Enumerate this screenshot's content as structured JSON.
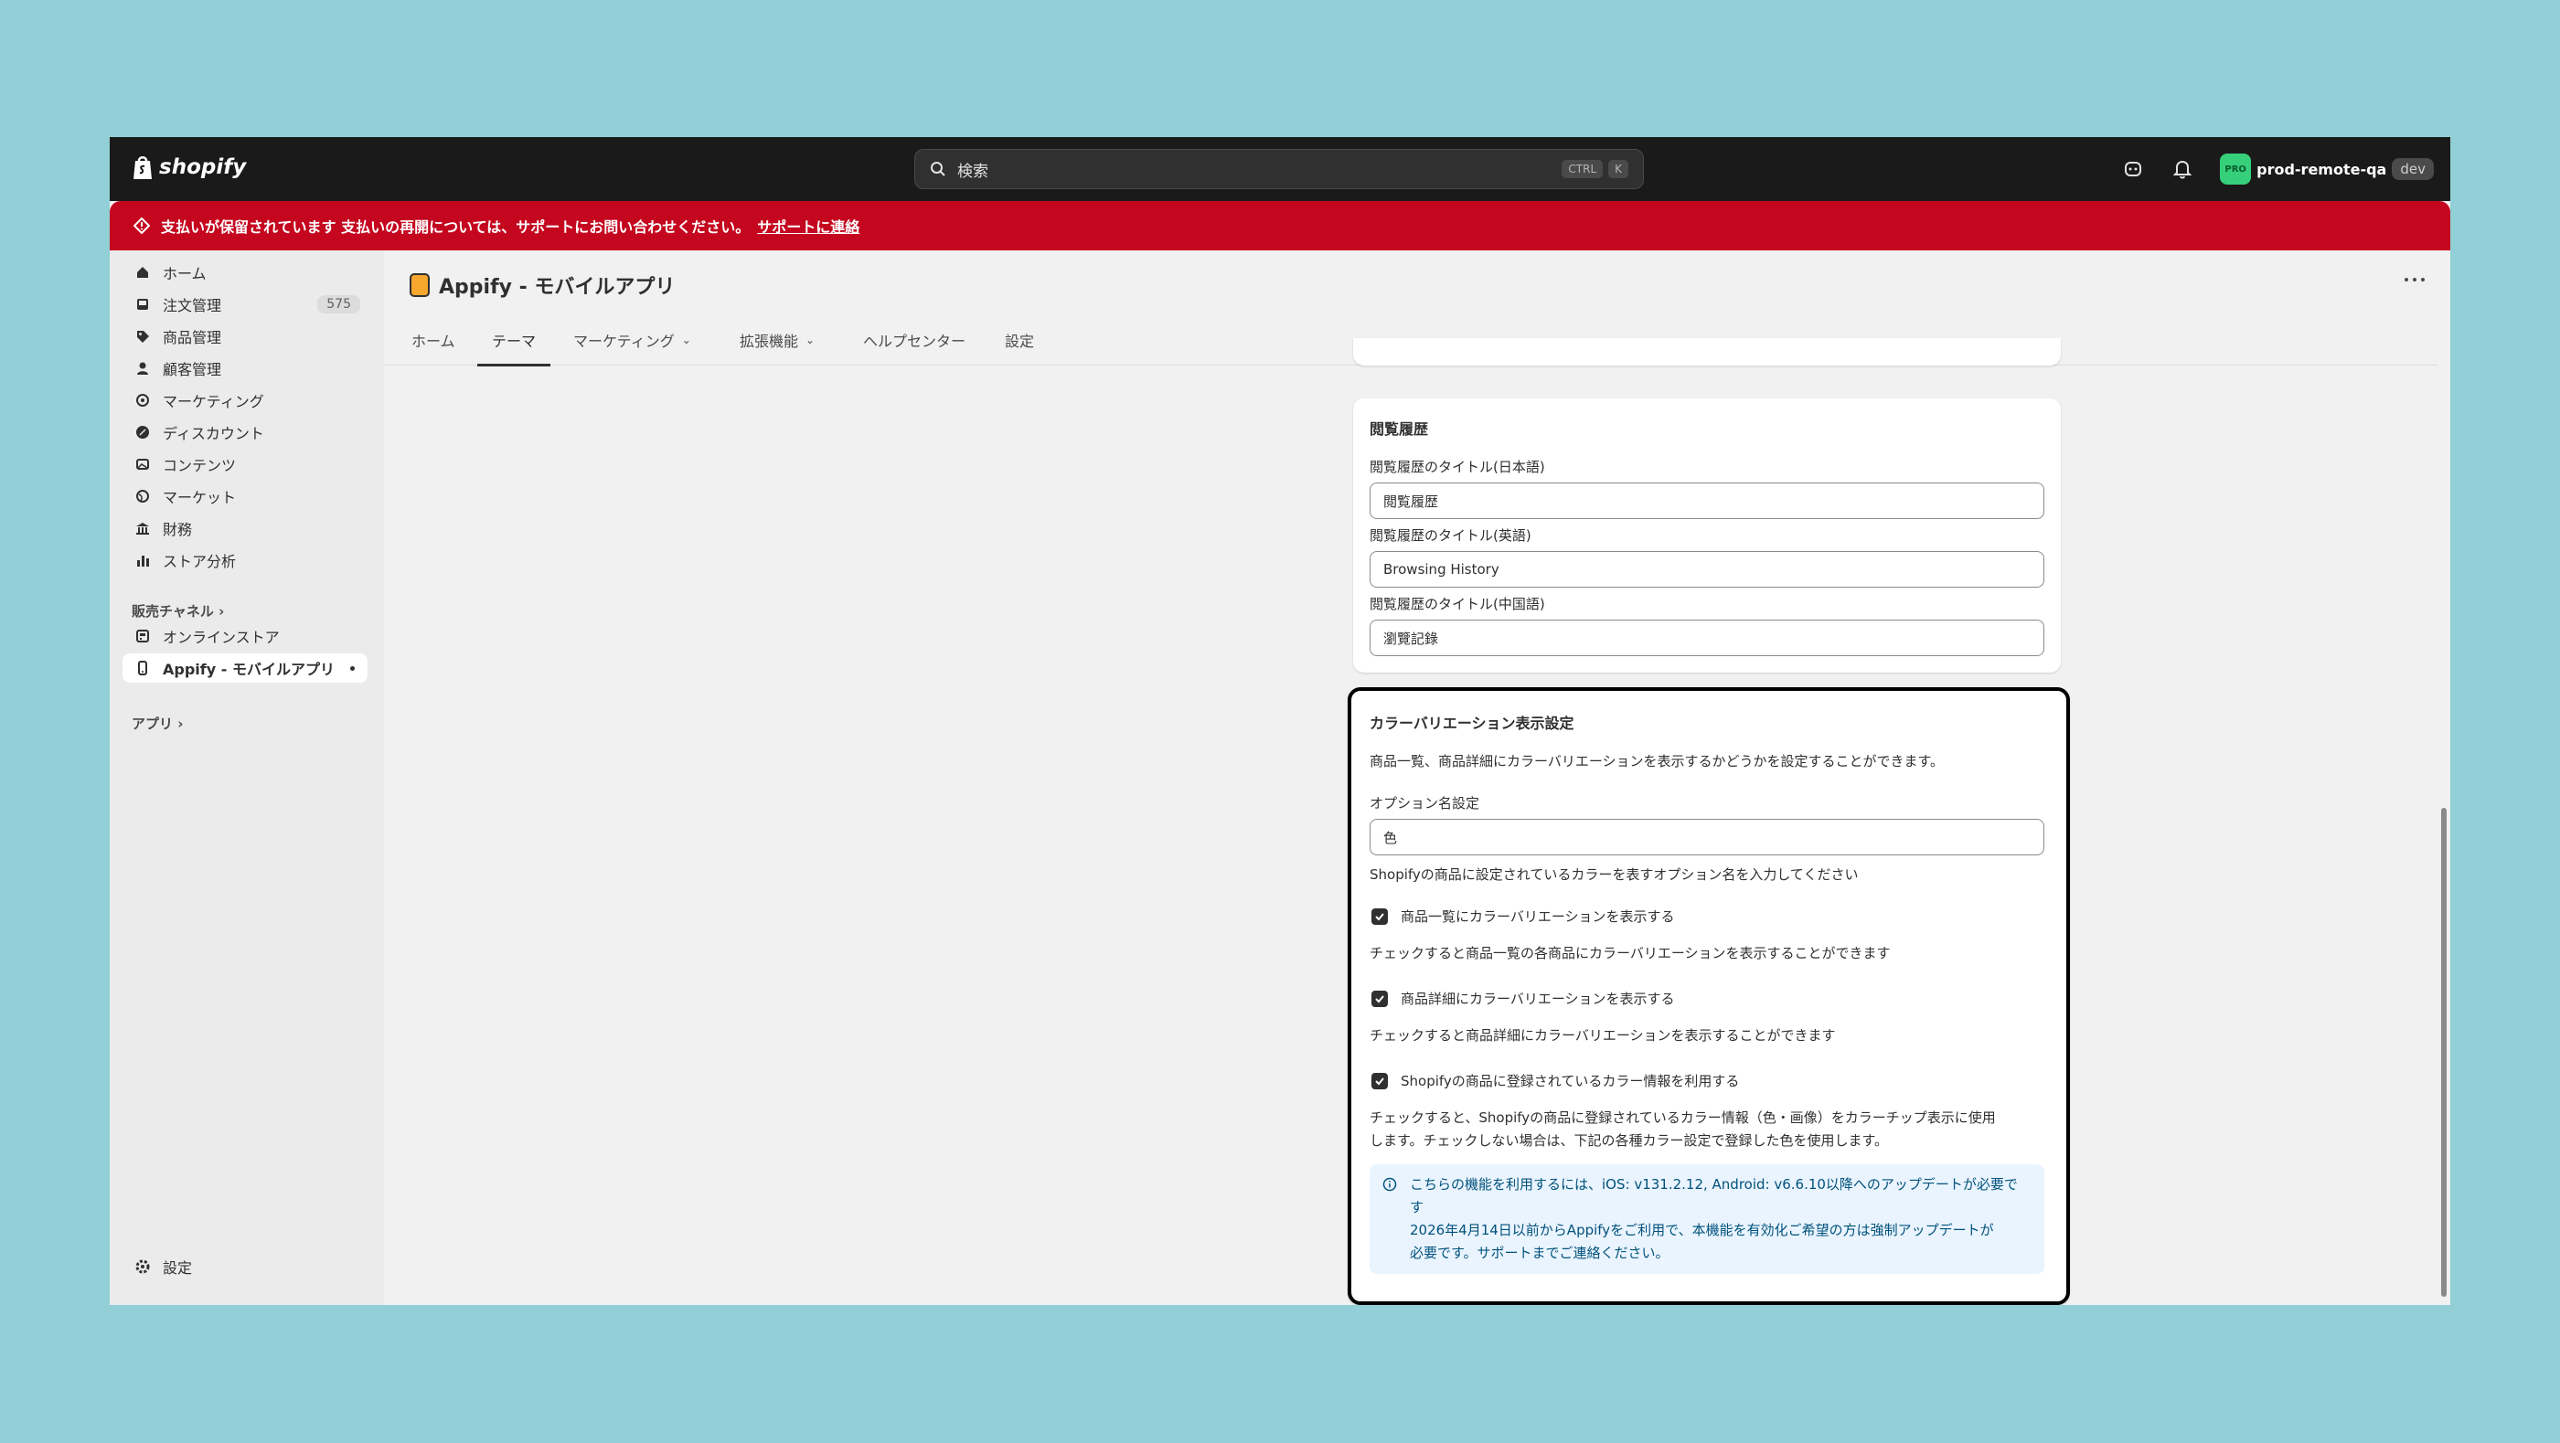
{
  "topbar": {
    "brand": "shopify",
    "search_placeholder": "検索",
    "shortcut_keys": [
      "CTRL",
      "K"
    ],
    "avatar_initials": "PRO",
    "store_name": "prod-remote-qa",
    "env_badge": "dev"
  },
  "alert": {
    "message": "支払いが保留されています 支払いの再開については、サポートにお問い合わせください。",
    "link_label": "サポートに連絡"
  },
  "sidebar": {
    "items": [
      {
        "label": "ホーム",
        "icon": "home-icon"
      },
      {
        "label": "注文管理",
        "icon": "inbox-icon",
        "badge": "575"
      },
      {
        "label": "商品管理",
        "icon": "tag-icon"
      },
      {
        "label": "顧客管理",
        "icon": "person-icon"
      },
      {
        "label": "マーケティング",
        "icon": "target-icon"
      },
      {
        "label": "ディスカウント",
        "icon": "discount-icon"
      },
      {
        "label": "コンテンツ",
        "icon": "image-icon"
      },
      {
        "label": "マーケット",
        "icon": "globe-icon"
      },
      {
        "label": "財務",
        "icon": "bank-icon"
      },
      {
        "label": "ストア分析",
        "icon": "bar-chart-icon"
      }
    ],
    "sales_channels_heading": "販売チャネル",
    "channels": [
      {
        "label": "オンラインストア",
        "icon": "store-icon"
      },
      {
        "label": "Appify - モバイルアプリ",
        "icon": "mobile-icon"
      }
    ],
    "apps_heading": "アプリ",
    "settings_label": "設定"
  },
  "page": {
    "title": "Appify - モバイルアプリ",
    "tabs": [
      {
        "label": "ホーム"
      },
      {
        "label": "テーマ"
      },
      {
        "label": "マーケティング"
      },
      {
        "label": "拡張機能"
      },
      {
        "label": "ヘルプセンター"
      },
      {
        "label": "設定"
      }
    ],
    "active_tab": "テーマ"
  },
  "browsing_history": {
    "title": "閲覧履歴",
    "fields": [
      {
        "label": "閲覧履歴のタイトル(日本語)",
        "value": "閲覧履歴"
      },
      {
        "label": "閲覧履歴のタイトル(英語)",
        "value": "Browsing History"
      },
      {
        "label": "閲覧履歴のタイトル(中国語)",
        "value": "瀏覽記錄"
      }
    ]
  },
  "color_variation": {
    "title": "カラーバリエーション表示設定",
    "description": "商品一覧、商品詳細にカラーバリエーションを表示するかどうかを設定することができます。",
    "option_label": "オプション名設定",
    "option_value": "色",
    "option_help": "Shopifyの商品に設定されているカラーを表すオプション名を入力してください",
    "checkboxes": [
      {
        "label": "商品一覧にカラーバリエーションを表示する",
        "help": "チェックすると商品一覧の各商品にカラーバリエーションを表示することができます",
        "checked": true
      },
      {
        "label": "商品詳細にカラーバリエーションを表示する",
        "help": "チェックすると商品詳細にカラーバリエーションを表示することができます",
        "checked": true
      },
      {
        "label": "Shopifyの商品に登録されているカラー情報を利用する",
        "help_line1": "チェックすると、Shopifyの商品に登録されているカラー情報（色・画像）をカラーチップ表示に使用",
        "help_line2": "します。チェックしない場合は、下記の各種カラー設定で登録した色を使用します。",
        "checked": true
      }
    ],
    "info_lines": [
      "こちらの機能を利用するには、iOS: v131.2.12, Android: v6.6.10以降へのアップデートが必要で",
      "す",
      "2026年4月14日以前からAppifyをご利用で、本機能を有効化ご希望の方は強制アップデートが",
      "必要です。サポートまでご連絡ください。"
    ]
  }
}
